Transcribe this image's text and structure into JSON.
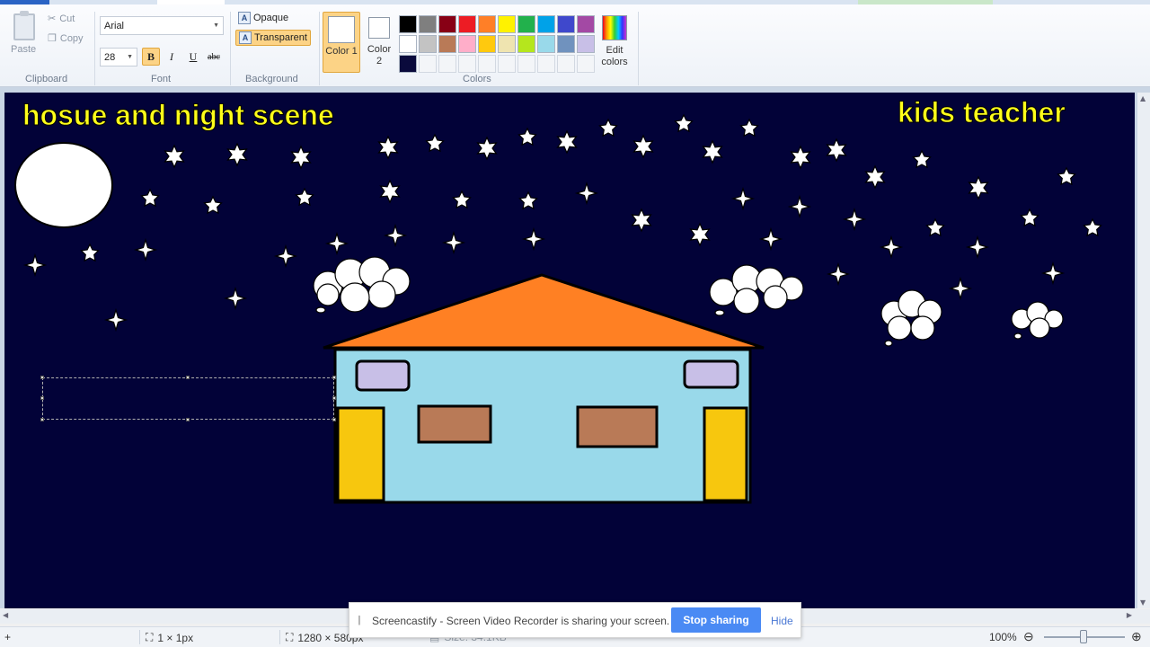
{
  "ribbon": {
    "clipboard": {
      "paste": "Paste",
      "cut": "Cut",
      "copy": "Copy",
      "label": "Clipboard"
    },
    "font": {
      "family": "Arial",
      "size": "28",
      "bold": "B",
      "italic": "I",
      "underline": "U",
      "strikethrough": "abc",
      "label": "Font"
    },
    "background": {
      "opaque": "Opaque",
      "transparent": "Transparent",
      "label": "Background"
    },
    "colors": {
      "color1_label": "Color 1",
      "color1_num": "1",
      "color2_label": "Color",
      "color2_num": "2",
      "edit_colors_1": "Edit",
      "edit_colors_2": "colors",
      "label": "Colors",
      "palette": [
        "#000000",
        "#7f7f7f",
        "#880015",
        "#ed1c24",
        "#ff7f27",
        "#fff200",
        "#22b14c",
        "#00a2e8",
        "#3f48cc",
        "#a349a4",
        "#ffffff",
        "#c3c3c3",
        "#b97a57",
        "#ffaec9",
        "#ffc90e",
        "#efe4b0",
        "#b5e61d",
        "#99d9ea",
        "#7092be",
        "#c8bfe7",
        "#0a0a3c",
        "",
        "",
        "",
        "",
        "",
        "",
        "",
        "",
        ""
      ]
    }
  },
  "canvas": {
    "title_left": "hosue and night scene",
    "title_right": "kids teacher",
    "background": "#020238",
    "text_color": "#ffff1a",
    "roof_color": "#ff8023",
    "wall_color": "#99d9ea",
    "door_color": "#f7c70e",
    "window_color": "#b97a57",
    "top_window_color": "#c8bfe7"
  },
  "statusbar": {
    "selection_size": "1 × 1px",
    "image_size": "1280 × 580px",
    "file_size": "Size: 34.1KB",
    "zoom": "100%"
  },
  "share_bar": {
    "message": "Screencastify - Screen Video Recorder is sharing your screen.",
    "stop": "Stop sharing",
    "hide": "Hide"
  }
}
